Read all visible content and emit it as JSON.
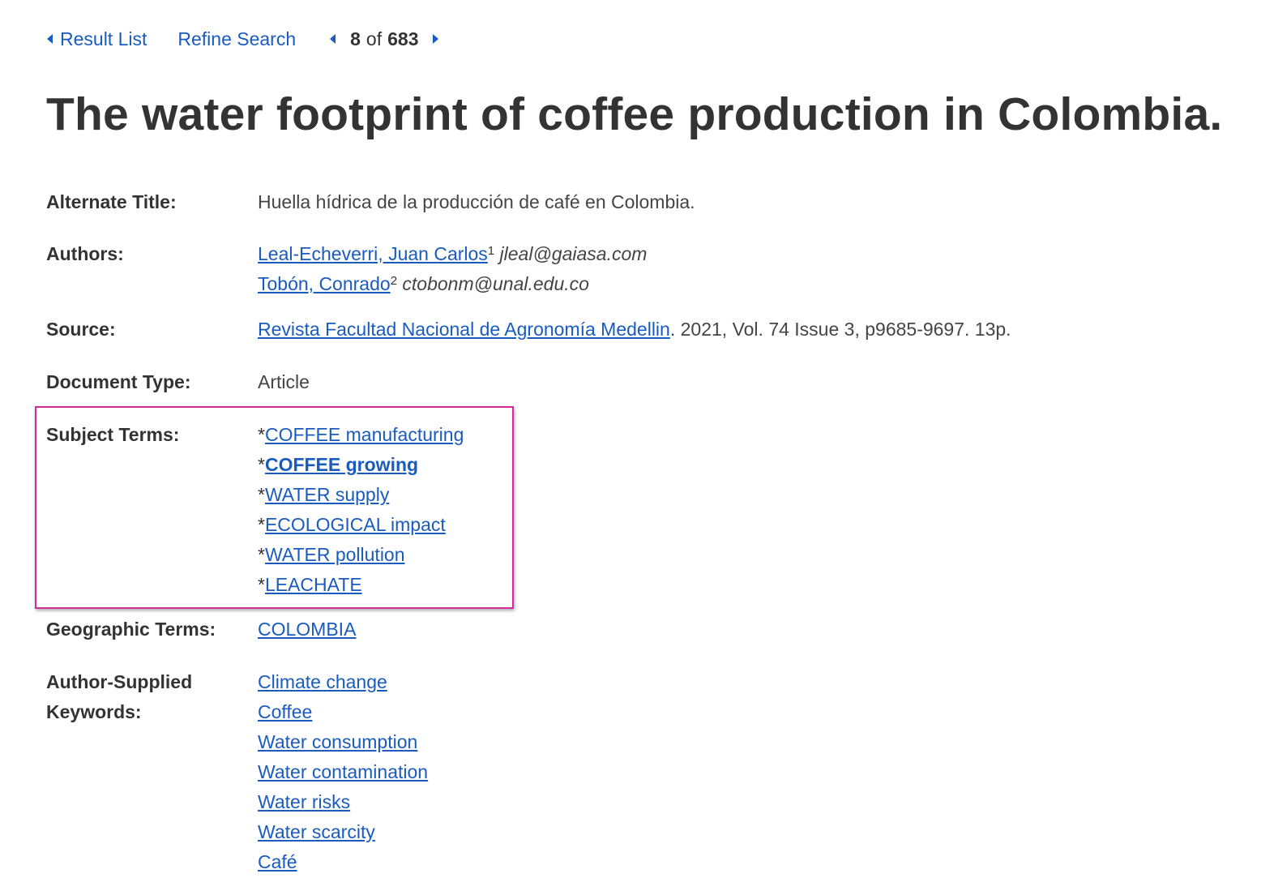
{
  "nav": {
    "result_list": "Result List",
    "refine_search": "Refine Search",
    "current": "8",
    "of": "of",
    "total": "683"
  },
  "record": {
    "title": "The water footprint of coffee production in Colombia.",
    "alternate_title": {
      "label": "Alternate Title:",
      "value": "Huella hídrica de la producción de café en Colombia."
    },
    "authors": {
      "label": "Authors:",
      "items": [
        {
          "name": "Leal-Echeverri, Juan Carlos",
          "aff": "1",
          "email": "jleal@gaiasa.com"
        },
        {
          "name": "Tobón, Conrado",
          "aff": "2",
          "email": "ctobonm@unal.edu.co"
        }
      ]
    },
    "source": {
      "label": "Source:",
      "journal": "Revista Facultad Nacional de Agronomía Medellin",
      "details": ". 2021, Vol. 74 Issue 3, p9685-9697. 13p."
    },
    "document_type": {
      "label": "Document Type:",
      "value": "Article"
    },
    "subject_terms": {
      "label": "Subject Terms:",
      "prefix": "*",
      "items": [
        "COFFEE manufacturing",
        "COFFEE growing",
        "WATER supply",
        "ECOLOGICAL impact",
        "WATER pollution",
        "LEACHATE"
      ]
    },
    "geographic_terms": {
      "label": "Geographic Terms:",
      "value": "COLOMBIA"
    },
    "author_keywords": {
      "label_line1": "Author-Supplied",
      "label_line2": "Keywords:",
      "items": [
        "Climate change",
        "Coffee",
        "Water consumption",
        "Water contamination",
        "Water risks",
        "Water scarcity",
        "Café"
      ]
    }
  },
  "colors": {
    "link": "#1a5bbf",
    "text": "#333333",
    "highlight_border": "#d42a9e"
  }
}
